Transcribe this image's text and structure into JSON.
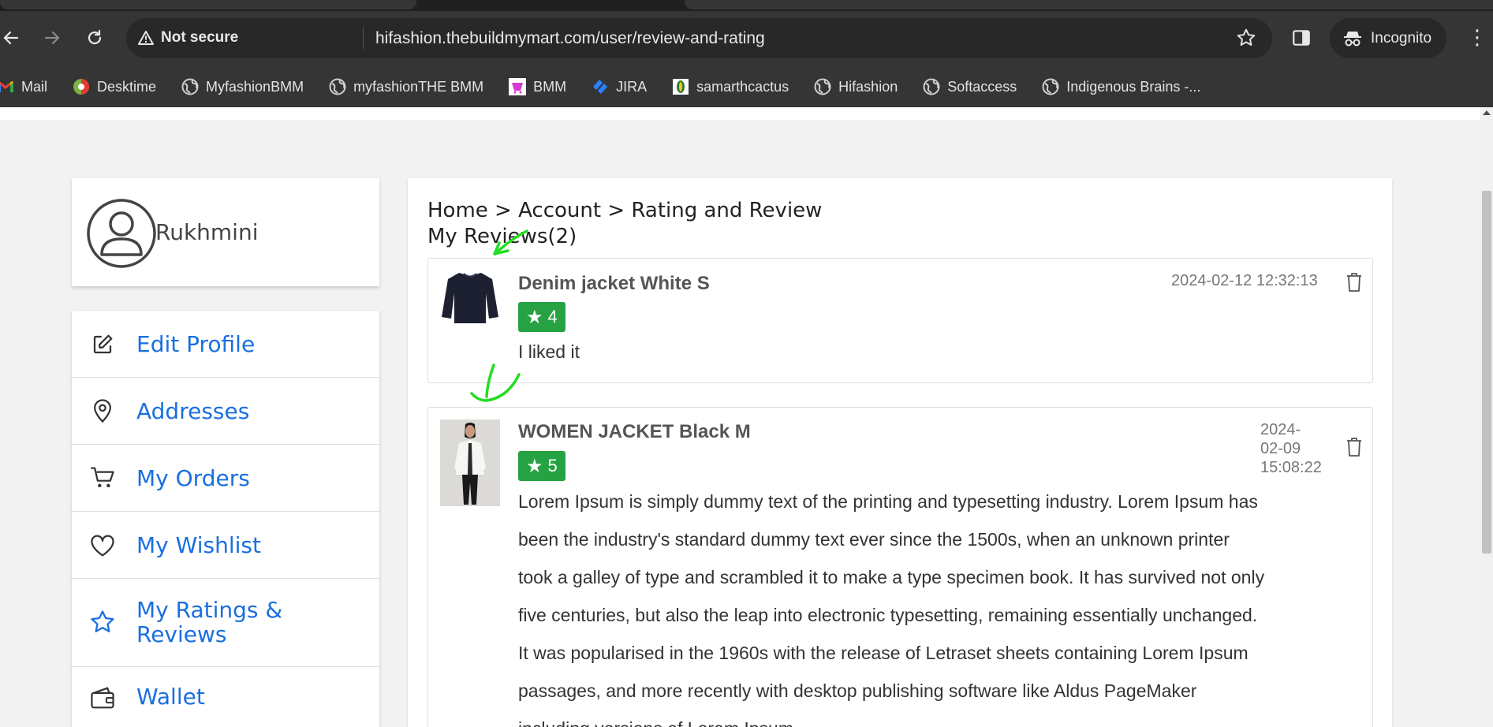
{
  "browser": {
    "security_label": "Not secure",
    "url": "hifashion.thebuildmymart.com/user/review-and-rating",
    "profile_label": "Incognito",
    "bookmarks": [
      "Mail",
      "Desktime",
      "MyfashionBMM",
      "myfashionTHE BMM",
      "BMM",
      "JIRA",
      "samarthcactus",
      "Hifashion",
      "Softaccess",
      "Indigenous Brains -..."
    ]
  },
  "profile": {
    "name": "Rukhmini"
  },
  "menu": {
    "items": [
      {
        "label": "Edit Profile",
        "icon": "edit-icon"
      },
      {
        "label": "Addresses",
        "icon": "location-pin-icon"
      },
      {
        "label": "My Orders",
        "icon": "cart-icon"
      },
      {
        "label": "My Wishlist",
        "icon": "heart-icon"
      },
      {
        "label": "My Ratings &",
        "label2": "Reviews",
        "icon": "star-icon"
      },
      {
        "label": "Wallet",
        "icon": "wallet-icon"
      }
    ]
  },
  "breadcrumb": {
    "text": "Home > Account > Rating and Review"
  },
  "reviews": {
    "title": "My Reviews(2)",
    "items": [
      {
        "product": "Denim jacket White S",
        "rating": "4",
        "date": "2024-02-12 12:32:13",
        "text": "I liked it"
      },
      {
        "product": "WOMEN JACKET Black M",
        "rating": "5",
        "date_line1": "2024-",
        "date_line2": "02-09",
        "date_line3": "15:08:22",
        "text": "Lorem Ipsum is simply dummy text of the printing and typesetting industry. Lorem Ipsum has been the industry's standard dummy text ever since the 1500s, when an unknown printer took a galley of type and scrambled it to make a type specimen book. It has survived not only five centuries, but also the leap into electronic typesetting, remaining essentially unchanged. It was popularised in the 1960s with the release of Letraset sheets containing Lorem Ipsum passages, and more recently with desktop publishing software like Aldus PageMaker including versions of Lorem Ipsum."
      }
    ]
  },
  "colors": {
    "link_blue": "#1a6fe0",
    "rating_green": "#27a243",
    "annotation_green": "#22dd22"
  }
}
